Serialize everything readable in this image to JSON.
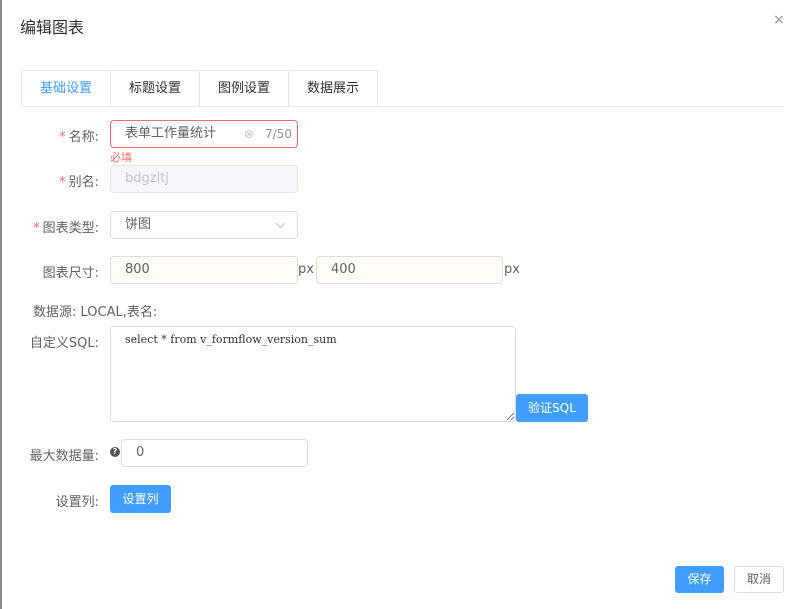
{
  "dialog": {
    "title": "编辑图表",
    "close_icon": "×"
  },
  "tabs": [
    {
      "label": "基础设置"
    },
    {
      "label": "标题设置"
    },
    {
      "label": "图例设置"
    },
    {
      "label": "数据展示"
    }
  ],
  "form": {
    "required_mark": "*",
    "name": {
      "label": "名称:",
      "value": "表单工作量统计",
      "count": "7/50",
      "error": "必填"
    },
    "alias": {
      "label": "别名:",
      "value": "bdgzltj"
    },
    "chart_type": {
      "label": "图表类型:",
      "value": "饼图"
    },
    "size": {
      "label": "图表尺寸:",
      "width": "800",
      "height": "400",
      "unit": "px"
    },
    "datasource": {
      "text": "数据源: LOCAL,表名:"
    },
    "sql": {
      "label": "自定义SQL:",
      "value": "select * from v_formflow_version_sum",
      "verify_button": "验证SQL"
    },
    "max_rows": {
      "label": "最大数据量:",
      "value": "0",
      "help_icon": "?"
    },
    "columns": {
      "label": "设置列:",
      "button": "设置列"
    }
  },
  "footer": {
    "save": "保存",
    "cancel": "取消"
  }
}
